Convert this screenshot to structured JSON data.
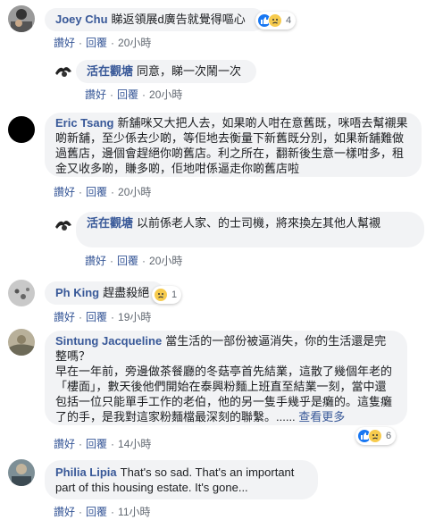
{
  "actions": {
    "like": "讚好",
    "reply": "回覆",
    "sep": "·"
  },
  "comments": [
    {
      "author": "Joey Chu",
      "text": "睇返領展d廣告就覺得嘔心",
      "time": "20小時",
      "reactions": [
        "like-icon",
        "sad-icon"
      ],
      "count": "4"
    },
    {
      "author": "活在觀塘",
      "text": "同意，睇一次鬧一次",
      "time": "20小時"
    },
    {
      "author": "Eric Tsang",
      "text": "新舖咪又大把人去，如果啲人咁在意舊既，咪唔去幫襯果啲新舖，至少係去少啲，等佢地去衡量下新舊既分別，如果新舖難做過舊店，邊個會趕絕你啲舊店。利之所在，翻新後生意一樣咁多，租金又收多啲，賺多啲，佢地咁係逼走你啲舊店啦",
      "time": "20小時"
    },
    {
      "author": "活在觀塘",
      "text": "以前係老人家、的士司機，將來換左其他人幫襯",
      "time": "20小時"
    },
    {
      "author": "Ph King",
      "text": "趕盡殺絕",
      "time": "19小時",
      "reactions": [
        "sad-icon"
      ],
      "count": "1"
    },
    {
      "author": "Sintung Jacqueline",
      "text": "當生活的一部份被逼消失，你的生活還是完整嗎？",
      "text2": "早在一年前，旁邊做茶餐廳的冬菇亭首先結業，這散了幾個年老的「樓面」，數天後他們開始在泰興粉麵上班直至結業一刻，當中還包括一位只能單手工作的老伯，他的另一隻手幾乎是癱的。這隻癱了的手，是我對這家粉麵檔最深刻的聯繫。......",
      "see_more": "查看更多",
      "time": "14小時",
      "reactions": [
        "like-icon",
        "sad-icon"
      ],
      "count": "6"
    },
    {
      "author": "Philia Lipia",
      "text": "That's so sad. That's an important part of this housing estate. It's gone...",
      "time": "11小時"
    }
  ],
  "colors": {
    "link": "#385898",
    "bubble": "#f2f3f5",
    "meta": "#606770",
    "like": "#1877f2",
    "sad": "#f7cb4d"
  }
}
